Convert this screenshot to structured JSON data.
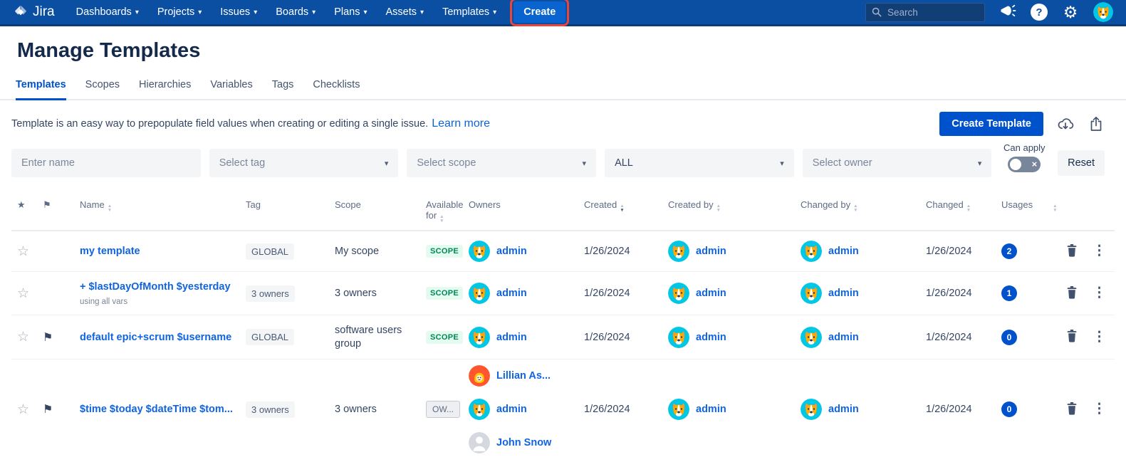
{
  "colors": {
    "nav_background": "#0B4FA3",
    "nav_button_blue": "#0A64D0",
    "accent_blue": "#0052CC",
    "link_blue": "#1164E0",
    "annotation_red": "#E8453C",
    "scope_badge_text": "#00875A",
    "scope_badge_bg": "#E3FCEF",
    "usage_badge_bg": "#0052CC",
    "avatar_teal": "#00C7E6",
    "avatar_orange": "#FF5630"
  },
  "nav": {
    "brand": "Jira",
    "items": [
      "Dashboards",
      "Projects",
      "Issues",
      "Boards",
      "Plans",
      "Assets",
      "Templates"
    ],
    "create_label": "Create",
    "search_placeholder": "Search"
  },
  "page": {
    "title": "Manage Templates",
    "tabs": [
      "Templates",
      "Scopes",
      "Hierarchies",
      "Variables",
      "Tags",
      "Checklists"
    ],
    "active_tab": "Templates",
    "description": "Template is an easy way to prepopulate field values when creating or editing a single issue.",
    "learn_more_label": "Learn more",
    "create_template_label": "Create Template"
  },
  "filters": {
    "name_placeholder": "Enter name",
    "tag_placeholder": "Select tag",
    "scope_placeholder": "Select scope",
    "type_value": "ALL",
    "owner_placeholder": "Select owner",
    "can_apply_label": "Can apply",
    "can_apply_state": "off",
    "reset_label": "Reset"
  },
  "table": {
    "headers": {
      "name": "Name",
      "tag": "Tag",
      "scope": "Scope",
      "available_for": "Available for",
      "owners": "Owners",
      "created": "Created",
      "created_by": "Created by",
      "changed_by": "Changed by",
      "changed": "Changed",
      "usages": "Usages"
    },
    "rows": [
      {
        "name": "my template",
        "flagged": false,
        "tag": "GLOBAL",
        "scope": "My scope",
        "available_for": "SCOPE",
        "owners": [
          {
            "name": "admin"
          }
        ],
        "created": "1/26/2024",
        "created_by": "admin",
        "changed_by": "admin",
        "changed": "1/26/2024",
        "usages": "2"
      },
      {
        "name": "+ $lastDayOfMonth $yesterday",
        "subtitle": "using all vars",
        "flagged": false,
        "tag": "3 owners",
        "scope": "3 owners",
        "available_for": "SCOPE",
        "owners": [
          {
            "name": "admin"
          }
        ],
        "created": "1/26/2024",
        "created_by": "admin",
        "changed_by": "admin",
        "changed": "1/26/2024",
        "usages": "1"
      },
      {
        "name": "default epic+scrum $username",
        "flagged": true,
        "tag": "GLOBAL",
        "scope": "software users group",
        "available_for": "SCOPE",
        "owners": [
          {
            "name": "admin"
          }
        ],
        "created": "1/26/2024",
        "created_by": "admin",
        "changed_by": "admin",
        "changed": "1/26/2024",
        "usages": "0"
      },
      {
        "name": "$time $today $dateTime $tom...",
        "flagged": true,
        "tag": "3 owners",
        "scope": "3 owners",
        "available_for": "OW...",
        "owners": [
          {
            "name": "Lillian As..."
          },
          {
            "name": "admin"
          },
          {
            "name": "John Snow"
          }
        ],
        "created": "1/26/2024",
        "created_by": "admin",
        "changed_by": "admin",
        "changed": "1/26/2024",
        "usages": "0"
      }
    ]
  }
}
